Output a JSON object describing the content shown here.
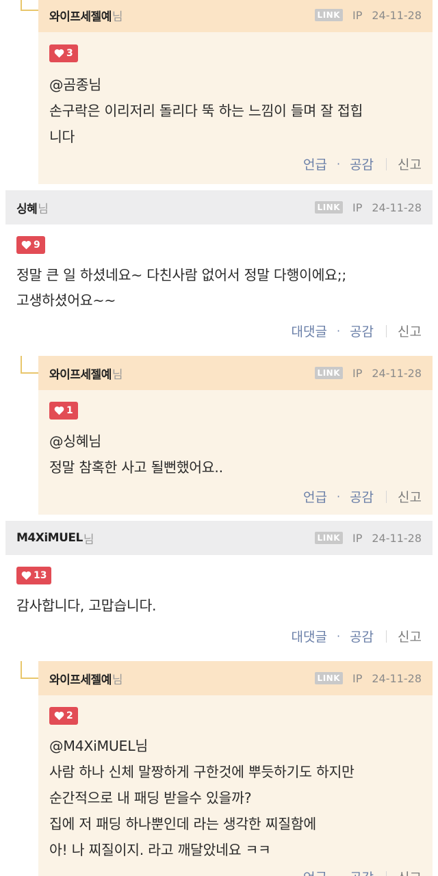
{
  "comments": [
    {
      "type": "reply",
      "author": "와이프세젤예",
      "suffix": "님",
      "link_label": "LINK",
      "ip_label": "IP",
      "date": "24-11-28",
      "likes": "3",
      "mention": "@곰종",
      "mention_suffix": "님",
      "lines": [
        "손구락은 이리저리 돌리다 뚝 하는 느낌이 들며 잘 접힙",
        "니다"
      ],
      "actions": {
        "primary": "언급",
        "empathy": "공감",
        "report": "신고"
      }
    },
    {
      "type": "comment",
      "author": "싱혜",
      "suffix": "님",
      "link_label": "LINK",
      "ip_label": "IP",
      "date": "24-11-28",
      "likes": "9",
      "lines": [
        "정말 큰 일 하셨네요~ 다친사람 없어서 정말 다행이에요;;",
        "고생하셨어요~~"
      ],
      "actions": {
        "primary": "대댓글",
        "empathy": "공감",
        "report": "신고"
      }
    },
    {
      "type": "reply",
      "author": "와이프세젤예",
      "suffix": "님",
      "link_label": "LINK",
      "ip_label": "IP",
      "date": "24-11-28",
      "likes": "1",
      "mention": "@싱혜",
      "mention_suffix": "님",
      "lines": [
        "정말 참혹한 사고 될뻔했어요.."
      ],
      "actions": {
        "primary": "언급",
        "empathy": "공감",
        "report": "신고"
      }
    },
    {
      "type": "comment",
      "author": "M4XiMUEL",
      "suffix": "님",
      "link_label": "LINK",
      "ip_label": "IP",
      "date": "24-11-28",
      "likes": "13",
      "lines": [
        "감사합니다, 고맙습니다."
      ],
      "actions": {
        "primary": "대댓글",
        "empathy": "공감",
        "report": "신고"
      }
    },
    {
      "type": "reply",
      "author": "와이프세젤예",
      "suffix": "님",
      "link_label": "LINK",
      "ip_label": "IP",
      "date": "24-11-28",
      "likes": "2",
      "mention": "@M4XiMUEL",
      "mention_suffix": "님",
      "lines": [
        "사람 하나 신체 말짱하게 구한것에 뿌듯하기도 하지만",
        "순간적으로 내 패딩 받을수 있을까?",
        "집에 저 패딩 하나뿐인데 라는 생각한 찌질함에",
        "아! 나 찌질이지. 라고 깨달았네요 ㅋㅋ"
      ],
      "actions": {
        "primary": "언급",
        "empathy": "공감",
        "report": "신고"
      }
    }
  ],
  "colors": {
    "reply_bg": "#fbf3e6",
    "reply_header": "#fbe4c6",
    "comment_header": "#ededee",
    "heart_badge": "#e24c55",
    "action_text": "#6a7fa8"
  },
  "icons": {
    "like": "heart-icon"
  }
}
